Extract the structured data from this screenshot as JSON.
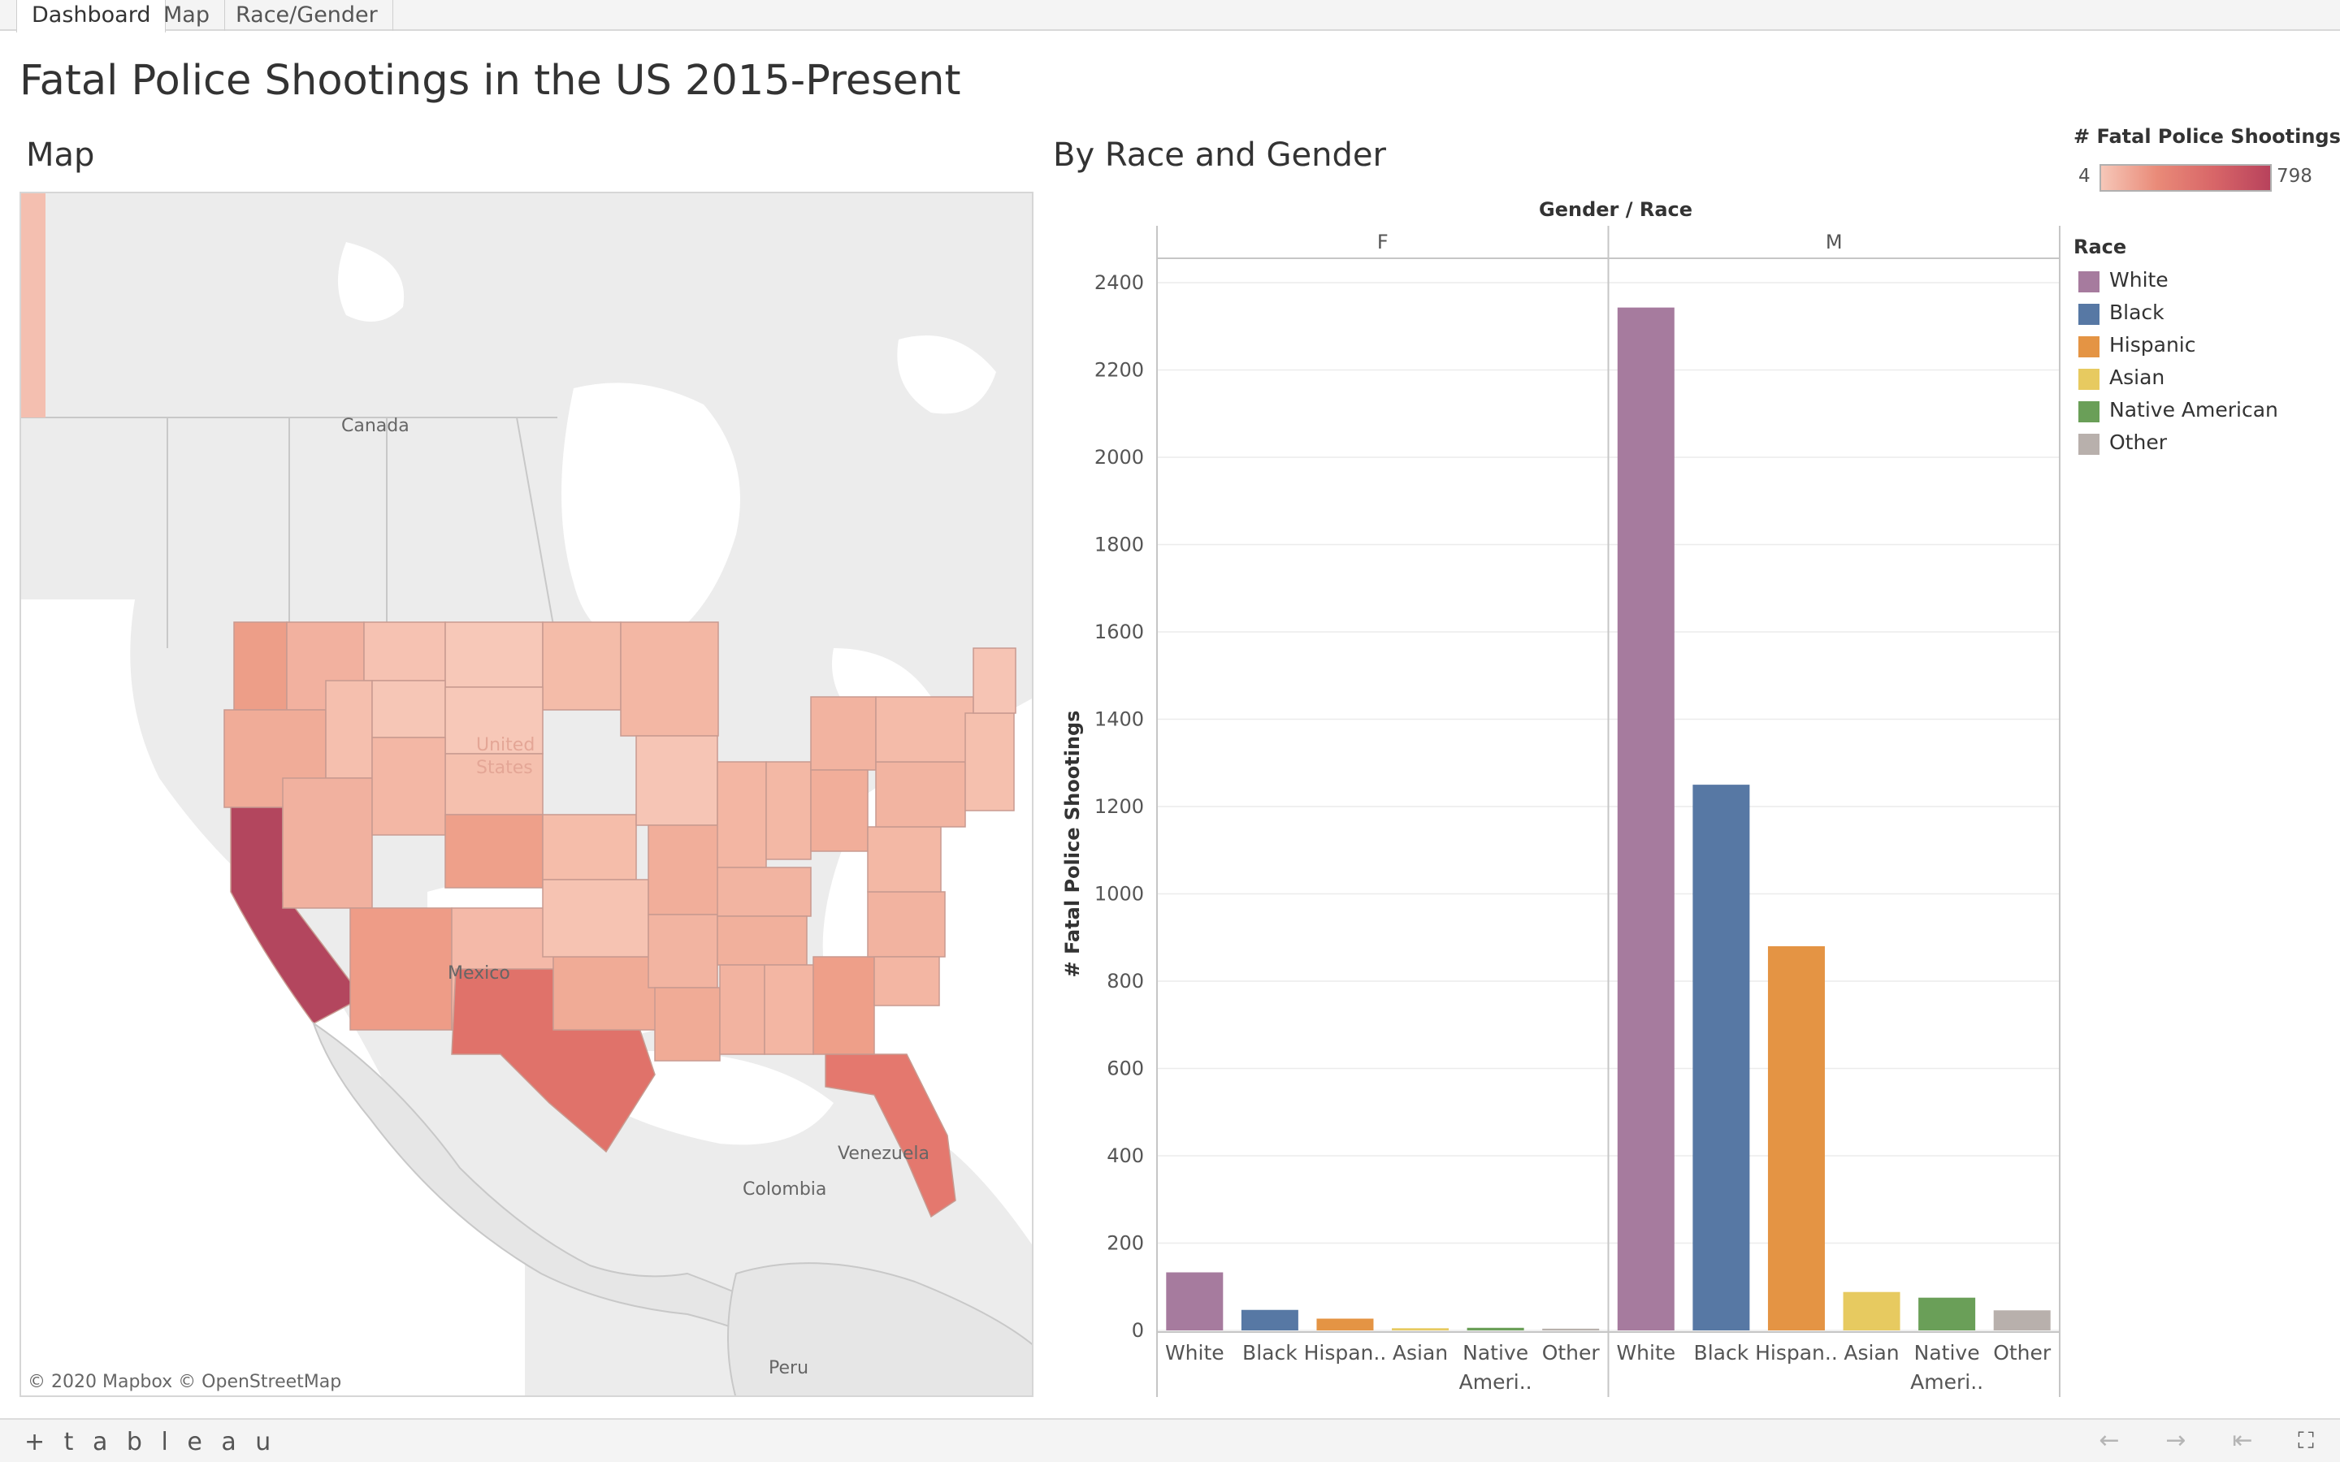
{
  "tabs": [
    {
      "label": "Dashboard",
      "active": true
    },
    {
      "label": "Map",
      "active": false
    },
    {
      "label": "Race/Gender",
      "active": false
    }
  ],
  "page_title": "Fatal Police Shootings in the US 2015-Present",
  "map": {
    "title": "Map",
    "labels": {
      "canada": "Canada",
      "mexico": "Mexico",
      "us": "United States",
      "venezuela": "Venezuela",
      "colombia": "Colombia",
      "peru": "Peru"
    },
    "attribution": "© 2020 Mapbox  © OpenStreetMap"
  },
  "color_legend": {
    "title": "# Fatal Police Shootings",
    "min": "4",
    "max": "798"
  },
  "chart_section_title": "By Race and Gender",
  "chart_data": {
    "type": "bar",
    "column_header": "Gender / Race",
    "ylabel": "# Fatal Police Shootings",
    "ylim": [
      0,
      2400
    ],
    "yticks": [
      "0",
      "200",
      "400",
      "600",
      "800",
      "1000",
      "1200",
      "1400",
      "1600",
      "1800",
      "2000",
      "2200",
      "2400"
    ],
    "panels": [
      {
        "name": "F",
        "categories": [
          "White",
          "Black",
          "Hispan..",
          "Asian",
          "Native Ameri..",
          "Other"
        ],
        "values": [
          133,
          47,
          27,
          5,
          6,
          4
        ]
      },
      {
        "name": "M",
        "categories": [
          "White",
          "Black",
          "Hispan..",
          "Asian",
          "Native Ameri..",
          "Other"
        ],
        "values": [
          2343,
          1250,
          880,
          88,
          75,
          46
        ]
      }
    ],
    "colors": [
      "#a67b9e",
      "#5778a4",
      "#e49444",
      "#e7ca60",
      "#6a9f58",
      "#b8b0ac"
    ],
    "legend": {
      "title": "Race",
      "entries": [
        "White",
        "Black",
        "Hispanic",
        "Asian",
        "Native American",
        "Other"
      ]
    }
  },
  "footer": {
    "brand": "+ t a b l e a u"
  }
}
